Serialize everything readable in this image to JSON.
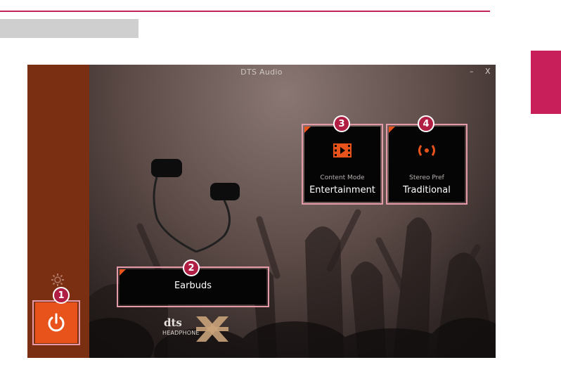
{
  "app": {
    "title": "DTS Audio",
    "minimize_label": "–",
    "close_label": "X"
  },
  "power": {
    "icon": "power-icon",
    "state": "on"
  },
  "settings": {
    "icon": "gear-icon"
  },
  "device": {
    "label": "Earbuds",
    "icon": "earbuds-icon"
  },
  "content_mode": {
    "caption": "Content Mode",
    "value": "Entertainment",
    "icon": "film-icon"
  },
  "stereo_pref": {
    "caption": "Stereo Pref",
    "value": "Traditional",
    "icon": "stereo-icon"
  },
  "logo": {
    "brand_text": "dts",
    "sub_text": "HEADPHONE",
    "mark": "X"
  },
  "callouts": [
    "1",
    "2",
    "3",
    "4"
  ],
  "colors": {
    "accent": "#e8531b",
    "sidebar": "#7a2f12",
    "highlight": "#e59aa9",
    "badge": "#b01e43",
    "brand_magenta": "#c81e5a"
  }
}
